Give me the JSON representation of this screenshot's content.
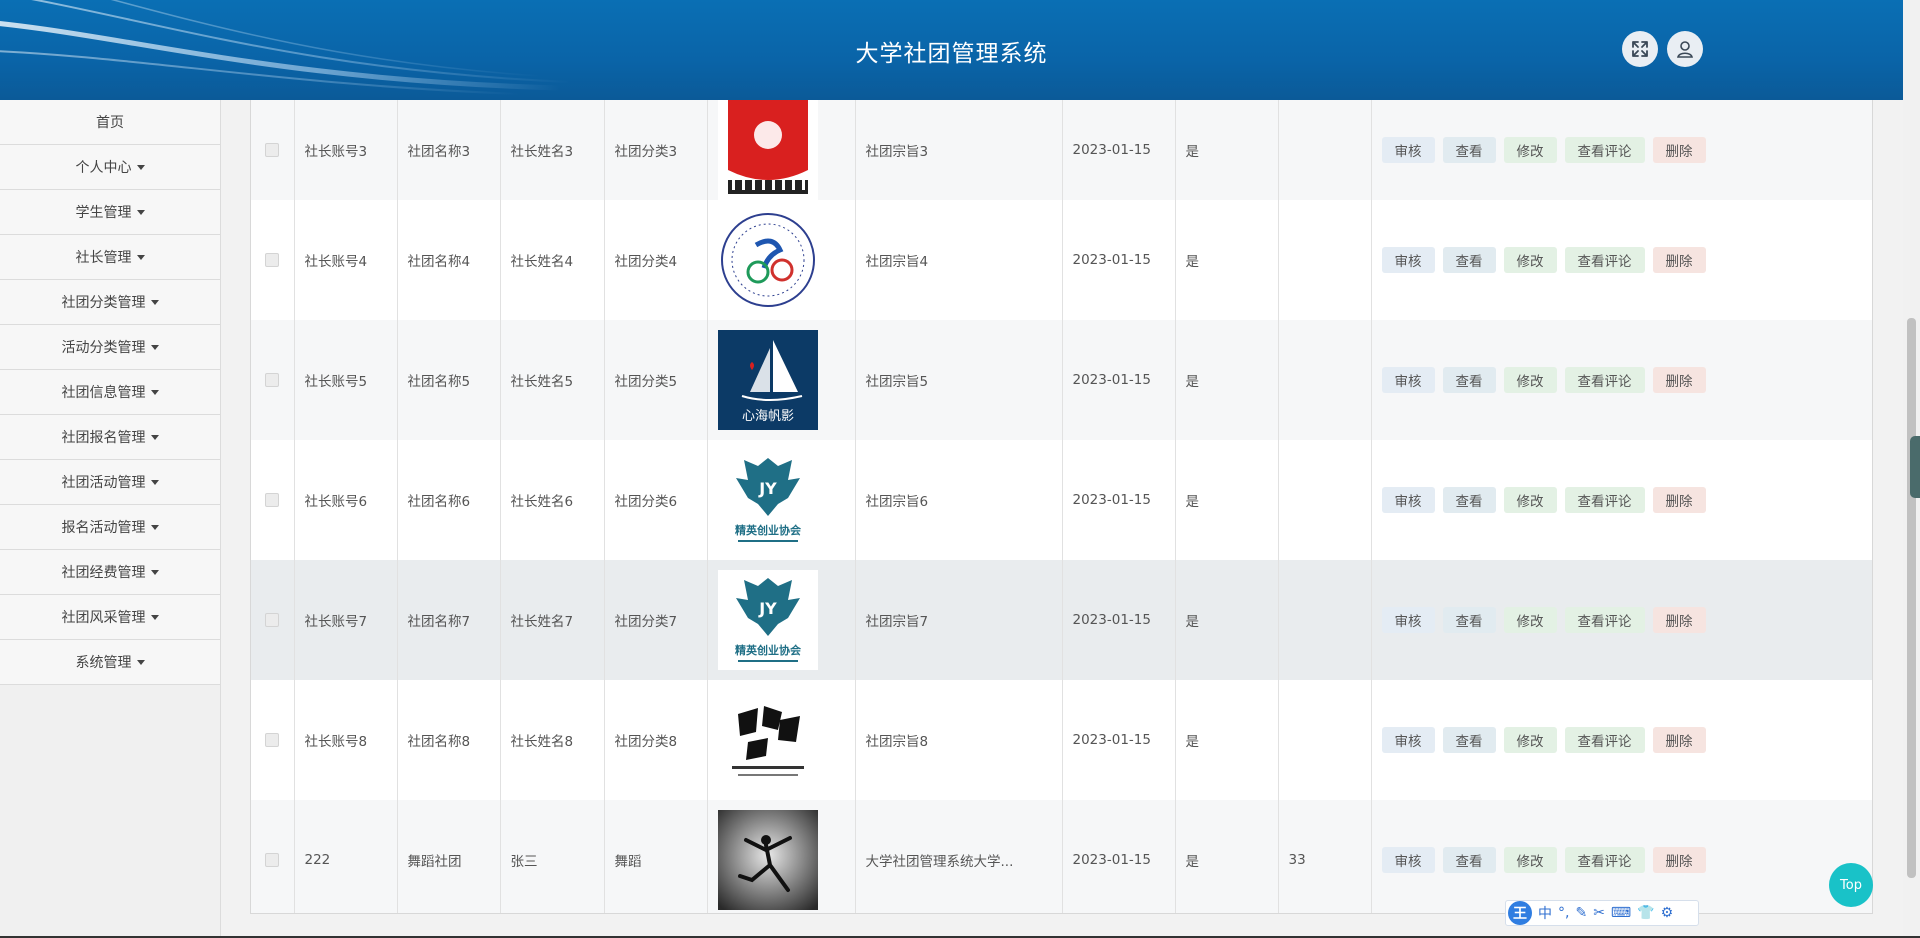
{
  "header": {
    "title": "大学社团管理系统"
  },
  "sidebar": {
    "items": [
      {
        "label": "首页",
        "dropdown": false
      },
      {
        "label": "个人中心",
        "dropdown": true
      },
      {
        "label": "学生管理",
        "dropdown": true
      },
      {
        "label": "社长管理",
        "dropdown": true
      },
      {
        "label": "社团分类管理",
        "dropdown": true
      },
      {
        "label": "活动分类管理",
        "dropdown": true
      },
      {
        "label": "社团信息管理",
        "dropdown": true
      },
      {
        "label": "社团报名管理",
        "dropdown": true
      },
      {
        "label": "社团活动管理",
        "dropdown": true
      },
      {
        "label": "报名活动管理",
        "dropdown": true
      },
      {
        "label": "社团经费管理",
        "dropdown": true
      },
      {
        "label": "社团风采管理",
        "dropdown": true
      },
      {
        "label": "系统管理",
        "dropdown": true
      }
    ]
  },
  "actions": {
    "audit": "审核",
    "view": "查看",
    "edit": "修改",
    "comments": "查看评论",
    "delete": "删除"
  },
  "rows": [
    {
      "account": "社长账号3",
      "club": "社团名称3",
      "name": "社长姓名3",
      "category": "社团分类3",
      "logo": "music-club-logo",
      "purpose": "社团宗旨3",
      "date": "2023-01-15",
      "flag": "是",
      "extra": ""
    },
    {
      "account": "社长账号4",
      "club": "社团名称4",
      "name": "社长姓名4",
      "category": "社团分类4",
      "logo": "cycling-club-logo",
      "purpose": "社团宗旨4",
      "date": "2023-01-15",
      "flag": "是",
      "extra": ""
    },
    {
      "account": "社长账号5",
      "club": "社团名称5",
      "name": "社长姓名5",
      "category": "社团分类5",
      "logo": "sailboat-club-logo",
      "logo_text": "心海帆影",
      "purpose": "社团宗旨5",
      "date": "2023-01-15",
      "flag": "是",
      "extra": ""
    },
    {
      "account": "社长账号6",
      "club": "社团名称6",
      "name": "社长姓名6",
      "category": "社团分类6",
      "logo": "eagle-club-logo",
      "logo_text": "精英创业协会",
      "purpose": "社团宗旨6",
      "date": "2023-01-15",
      "flag": "是",
      "extra": ""
    },
    {
      "account": "社长账号7",
      "club": "社团名称7",
      "name": "社长姓名7",
      "category": "社团分类7",
      "logo": "eagle-club-logo",
      "logo_text": "精英创业协会",
      "purpose": "社团宗旨7",
      "date": "2023-01-15",
      "flag": "是",
      "extra": ""
    },
    {
      "account": "社长账号8",
      "club": "社团名称8",
      "name": "社长姓名8",
      "category": "社团分类8",
      "logo": "calligraphy-club-logo",
      "purpose": "社团宗旨8",
      "date": "2023-01-15",
      "flag": "是",
      "extra": ""
    },
    {
      "account": "222",
      "club": "舞蹈社团",
      "name": "张三",
      "category": "舞蹈",
      "logo": "dancer-photo",
      "purpose": "大学社团管理系统大学...",
      "date": "2023-01-15",
      "flag": "是",
      "extra": "33"
    }
  ],
  "top_button": "Top",
  "ime": {
    "chinese_label": "中"
  },
  "colors": {
    "header": "#0a6fb4",
    "top_button": "#19c2c8"
  }
}
